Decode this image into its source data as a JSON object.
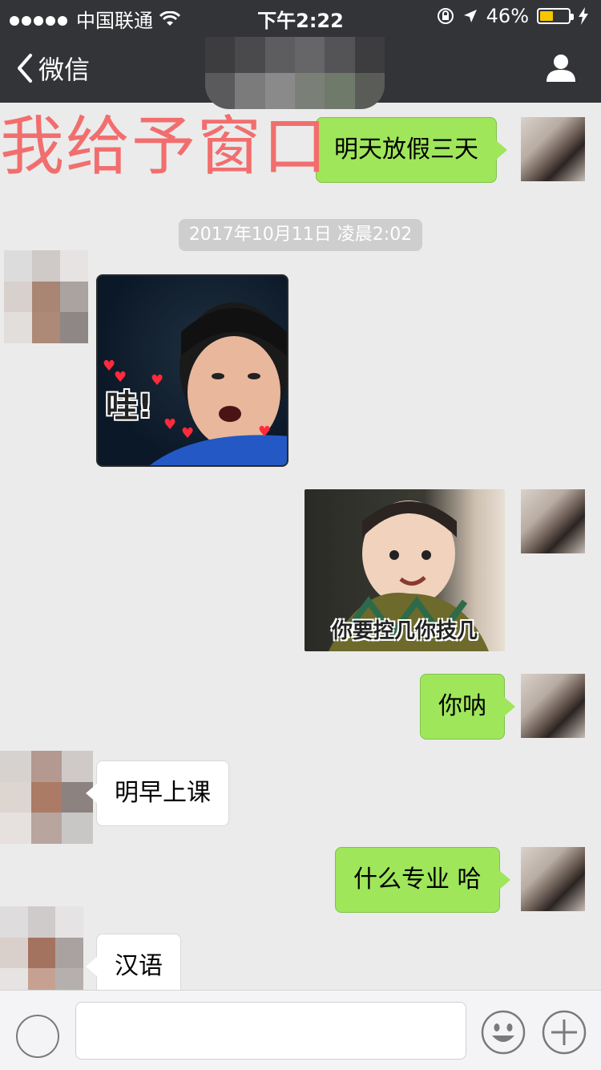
{
  "status_bar": {
    "carrier": "中国联通",
    "time": "下午2:22",
    "battery_pct": "46%",
    "battery_level": 0.46
  },
  "nav": {
    "back_label": "微信"
  },
  "overlay_text": "我给予窗口",
  "timestamp": "2017年10月11日 凌晨2:02",
  "messages": {
    "m1": "明天放假三天",
    "m2_caption": "哇!",
    "m3_caption": "你要控几你技几",
    "m4": "你呐",
    "m5": "明早上课",
    "m6": "什么专业 哈",
    "m7": "汉语"
  },
  "colors": {
    "green_bubble": "#9fe65b",
    "header_bg": "#333437",
    "overlay_red": "#f26e6e"
  }
}
